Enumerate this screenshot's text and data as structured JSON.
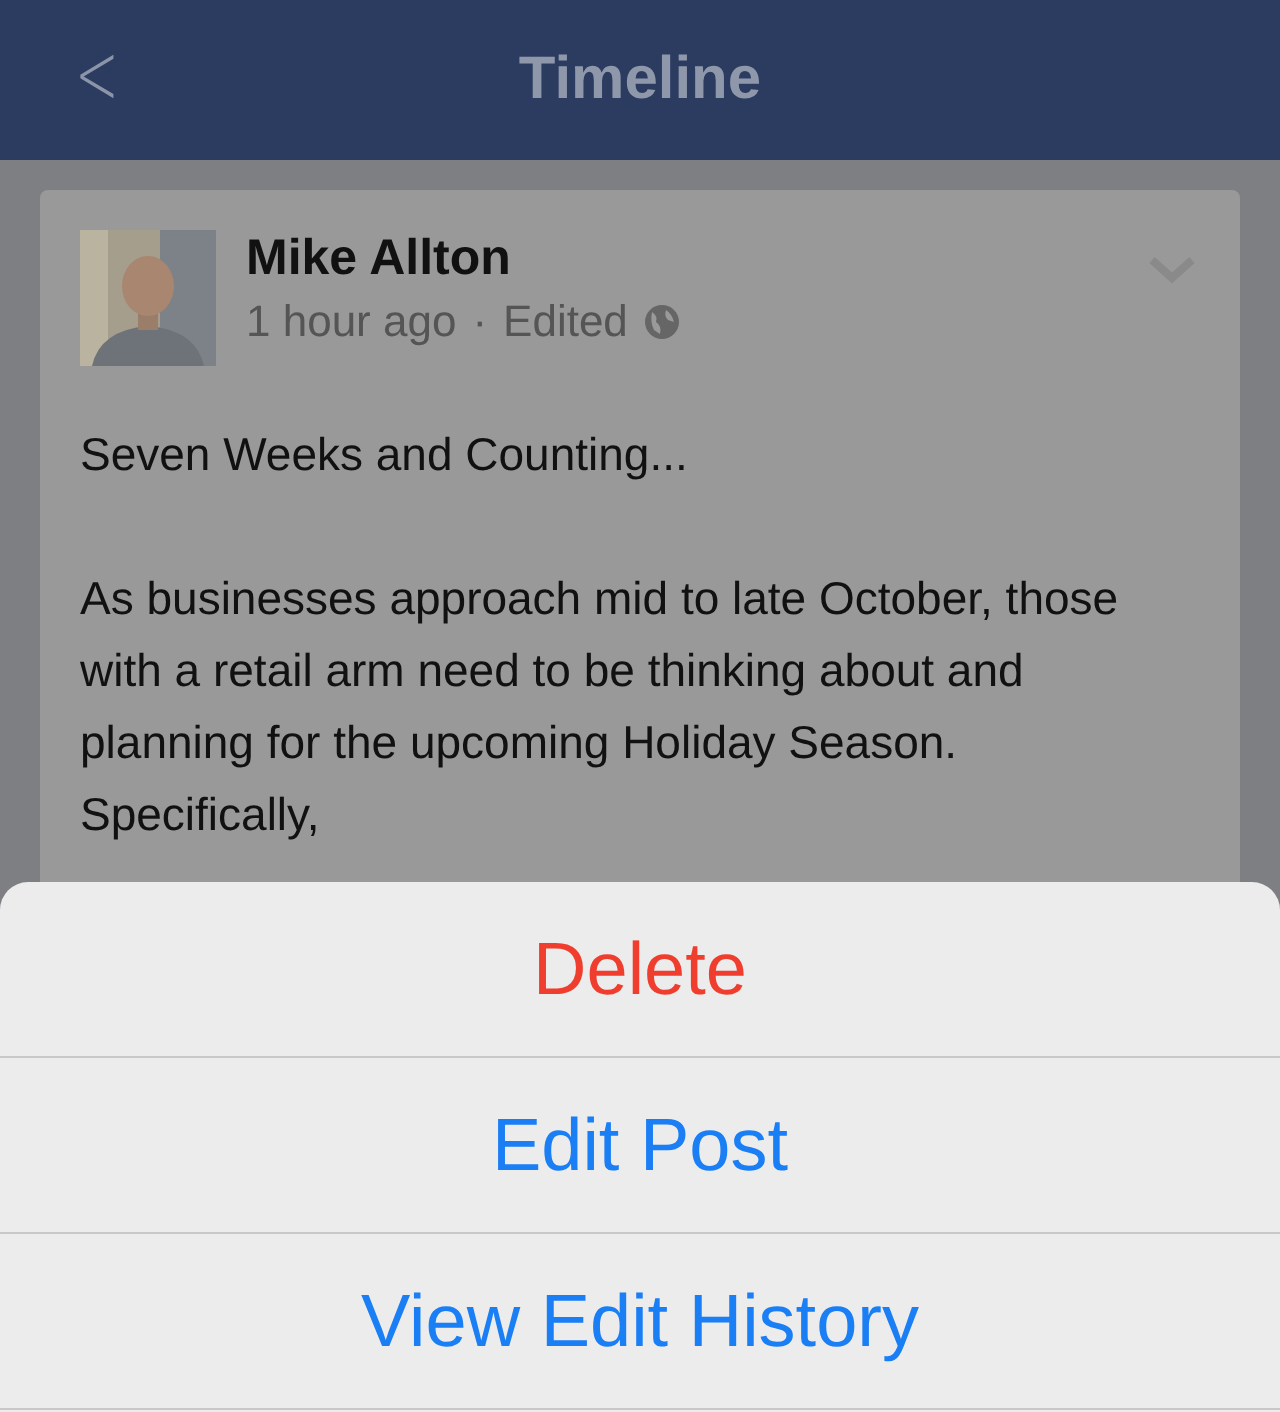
{
  "nav_bar": {
    "back": "<",
    "title": "Timeline"
  },
  "post": {
    "author": "Mike Allton",
    "time": "1 hour ago",
    "separator": "·",
    "edited": "Edited",
    "title": "Seven Weeks and Counting...",
    "body": "As businesses approach mid to late October, those with a retail arm need to be thinking about and planning for the upcoming Holiday Season. Specifically,"
  },
  "action_sheet": [
    {
      "label": "Delete",
      "kind": "destructive"
    },
    {
      "label": "Edit Post",
      "kind": "default"
    },
    {
      "label": "View Edit History",
      "kind": "default"
    }
  ]
}
